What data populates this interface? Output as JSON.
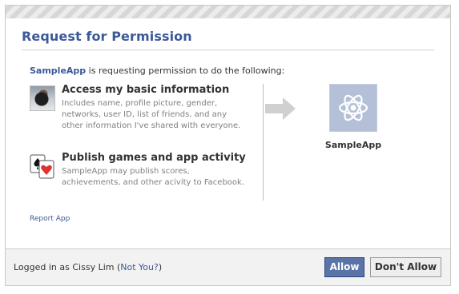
{
  "dialog": {
    "title": "Request for Permission",
    "intro_app": "SampleApp",
    "intro_text": " is requesting permission to do the following:"
  },
  "permissions": [
    {
      "title": "Access my basic information",
      "desc": "Includes name, profile picture, gender, networks, user ID, list of friends, and any other information I've shared with everyone.",
      "icon": "user-photo-icon"
    },
    {
      "title": "Publish games and app activity",
      "desc": "SampleApp may publish scores, achievements, and other acivity to Facebook.",
      "icon": "playing-cards-icon"
    }
  ],
  "app": {
    "name": "SampleApp",
    "icon": "atom-icon"
  },
  "report_link": "Report App",
  "footer": {
    "logged_prefix": "Logged in as Cissy Lim (",
    "not_you": "Not You?",
    "logged_suffix": ")",
    "allow": "Allow",
    "dont_allow": "Don't Allow"
  },
  "colors": {
    "brand": "#3b5998",
    "allow_button": "#5b74a8",
    "app_icon_bg": "#b4c0d8"
  }
}
